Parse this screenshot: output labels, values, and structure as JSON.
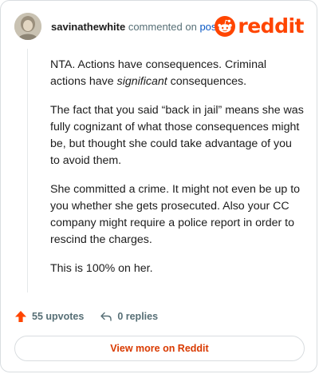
{
  "comment": {
    "author": "savinathewhite",
    "action_text": "commented on",
    "post_link": "post",
    "avatar_icon": "user-avatar-photo",
    "paragraphs": [
      {
        "before": "NTA. Actions have consequences. Criminal actions have ",
        "emphasis": "significant",
        "after": " consequences."
      },
      {
        "text": "The fact that you said “back in jail” means she was fully cognizant of what those consequences might be, but thought she could take advantage of you to avoid them."
      },
      {
        "text": "She committed a crime. It might not even be up to you whether she gets prosecuted. Also your CC company might require a police report in order to rescind the charges."
      },
      {
        "text": "This is 100% on her."
      }
    ]
  },
  "brand": {
    "wordmark": "reddit",
    "icon": "reddit-snoo-icon",
    "color": "#ff4500"
  },
  "actions": {
    "upvotes_label": "55 upvotes",
    "upvote_icon": "upvote-arrow-icon",
    "replies_label": "0 replies",
    "reply_icon": "reply-arrow-icon"
  },
  "footer": {
    "view_more_label": "View more on Reddit"
  }
}
